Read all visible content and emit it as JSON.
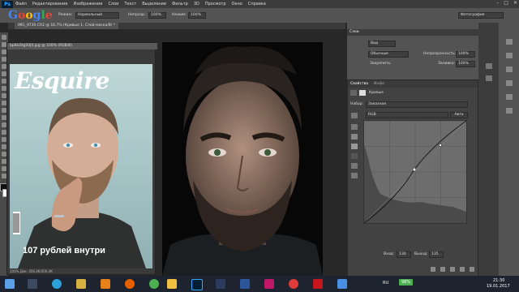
{
  "menubar": {
    "app_icon": "Ps",
    "items": [
      "Файл",
      "Редактирование",
      "Изображение",
      "Слои",
      "Текст",
      "Выделение",
      "Фильтр",
      "3D",
      "Просмотр",
      "Окно",
      "Справка"
    ],
    "window_controls": [
      "minimize-icon",
      "maximize-icon",
      "close-icon"
    ]
  },
  "optionsbar": {
    "logo_text": "Google",
    "mode_label": "Режим:",
    "mode_value": "Нормальный",
    "opacity_label": "Непрозр.:",
    "opacity_value": "100%",
    "flow_label": "Нажим:",
    "flow_value": "100%",
    "workspace_value": "Фотография"
  },
  "document_tab": {
    "title": "IMG_9730.CR2 @ 16,7% (Кривые 1, Слой-маска/8) *"
  },
  "magazine_window": {
    "title": "bp8U3tgS0J4.jpg @ 100% (RGB/8)",
    "status": "100%    Док: 456,4K/456,4K",
    "cover_title": "Esquire",
    "cover_price": "107 рублей внутри"
  },
  "layers_panel": {
    "tab": "Слои",
    "filter_value": "Вид",
    "blend_value": "Обычные",
    "opacity_label": "Непрозрачность:",
    "opacity_value": "100%",
    "lock_label": "Закрепить:",
    "fill_label": "Заливка:",
    "fill_value": "100%"
  },
  "properties_panel": {
    "tabs": [
      "Свойства",
      "Инфо"
    ],
    "title": "Кривые",
    "preset_label": "Набор:",
    "preset_value": "Заказная",
    "channel_value": "RGB",
    "auto_button": "Авто",
    "input_label": "Вход:",
    "input_value": "130",
    "output_label": "Выход:",
    "output_value": "135"
  },
  "taskbar": {
    "lang": "RU",
    "battery": "98%",
    "time": "21:30",
    "date": "19.01.2017",
    "apps": [
      "start-icon",
      "search-icon",
      "task-view-icon",
      "telegram-icon",
      "files-icon",
      "vlc-icon",
      "firefox-icon",
      "chrome-icon",
      "explorer-icon",
      "photoshop-icon",
      "lightroom-icon",
      "premiere-icon",
      "word-icon",
      "indesign-icon",
      "yandex-icon",
      "acrobat-icon",
      "mail-icon"
    ]
  },
  "colors": {
    "ps_blue": "#31a8ff",
    "panel_bg": "#535353",
    "dark_bg": "#282828",
    "taskbar_bg": "#1d2430"
  }
}
